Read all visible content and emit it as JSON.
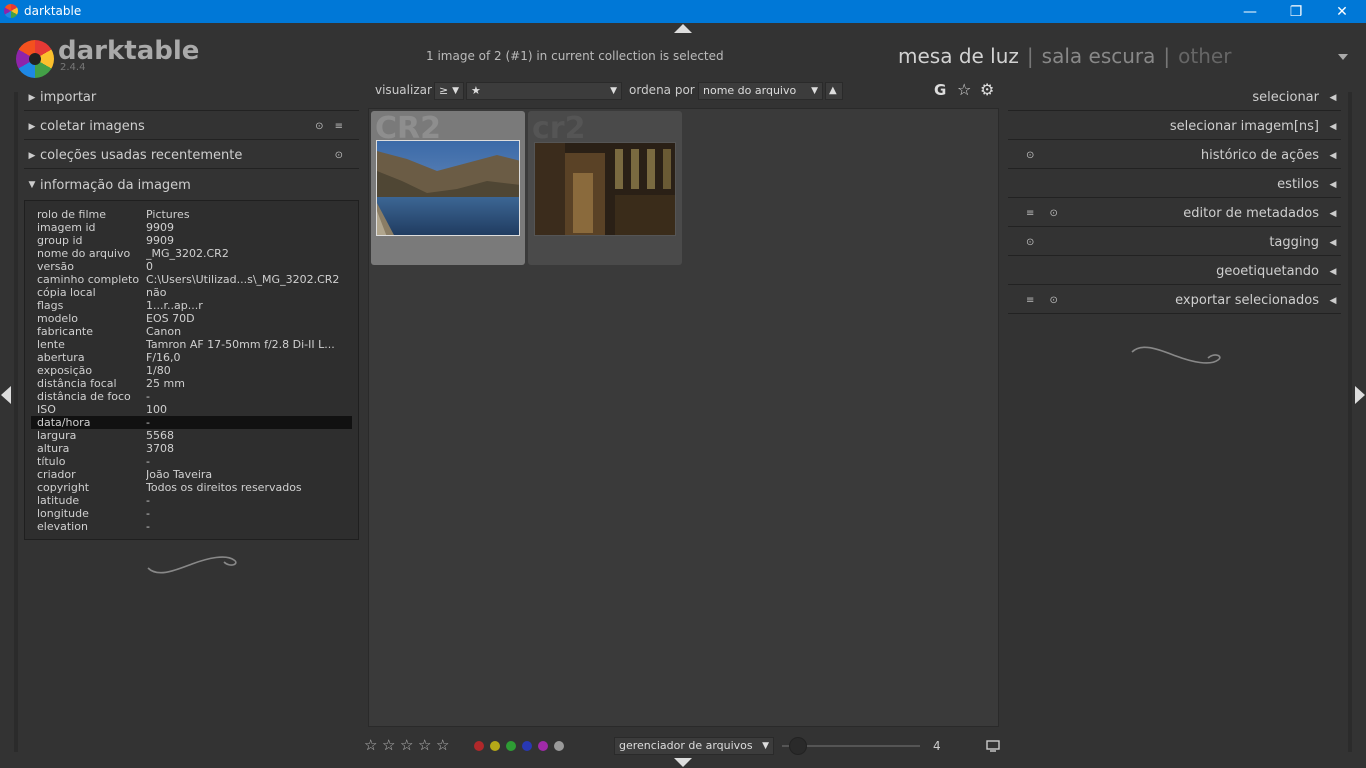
{
  "window": {
    "title": "darktable",
    "minimize": "—",
    "maximize": "❐",
    "close": "✕"
  },
  "logo": {
    "name": "darktable",
    "version": "2.4.4"
  },
  "status": "1 image of 2 (#1) in current collection is selected",
  "views": {
    "active": "mesa de luz",
    "second": "sala escura",
    "third": "other",
    "separator": "|"
  },
  "left_modules": [
    {
      "label": "importar",
      "expanded": false,
      "icons": ""
    },
    {
      "label": "coletar imagens",
      "expanded": false,
      "icons": "⊙ ≡"
    },
    {
      "label": "coleções usadas recentemente",
      "expanded": false,
      "icons": "⊙"
    },
    {
      "label": "informação da imagem",
      "expanded": true,
      "icons": ""
    }
  ],
  "image_info": [
    {
      "k": "rolo de filme",
      "v": "Pictures"
    },
    {
      "k": "imagem id",
      "v": "9909"
    },
    {
      "k": "group id",
      "v": "9909"
    },
    {
      "k": "nome do arquivo",
      "v": "_MG_3202.CR2"
    },
    {
      "k": "versão",
      "v": "0"
    },
    {
      "k": "caminho completo",
      "v": "C:\\Users\\Utilizad...s\\_MG_3202.CR2"
    },
    {
      "k": "cópia local",
      "v": "não"
    },
    {
      "k": "flags",
      "v": "1...r..ap...r"
    },
    {
      "k": "modelo",
      "v": "EOS 70D"
    },
    {
      "k": "fabricante",
      "v": "Canon"
    },
    {
      "k": "lente",
      "v": "Tamron AF 17-50mm f/2.8 Di-II L..."
    },
    {
      "k": "abertura",
      "v": "F/16,0"
    },
    {
      "k": "exposição",
      "v": "1/80"
    },
    {
      "k": "distância focal",
      "v": "25 mm"
    },
    {
      "k": "distância de foco",
      "v": "-"
    },
    {
      "k": "ISO",
      "v": "100"
    },
    {
      "k": "data/hora",
      "v": "-"
    },
    {
      "k": "largura",
      "v": "5568"
    },
    {
      "k": "altura",
      "v": "3708"
    },
    {
      "k": "título",
      "v": "-"
    },
    {
      "k": "criador",
      "v": "João Taveira"
    },
    {
      "k": "copyright",
      "v": "Todos os direitos reservados"
    },
    {
      "k": "latitude",
      "v": "-"
    },
    {
      "k": "longitude",
      "v": "-"
    },
    {
      "k": "elevation",
      "v": "-"
    }
  ],
  "right_modules": [
    {
      "label": "selecionar",
      "icons": ""
    },
    {
      "label": "selecionar imagem[ns]",
      "icons": ""
    },
    {
      "label": "histórico de ações",
      "icons": "⊙"
    },
    {
      "label": "estilos",
      "icons": ""
    },
    {
      "label": "editor de metadados",
      "icons": "≡ ⊙"
    },
    {
      "label": "tagging",
      "icons": "⊙"
    },
    {
      "label": "geoetiquetando",
      "icons": ""
    },
    {
      "label": "exportar selecionados",
      "icons": "≡ ⊙"
    }
  ],
  "toolbar": {
    "visualizar_label": "visualizar",
    "comparator": "≥",
    "rating_filter": "★",
    "sort_label": "ordena por",
    "sort_value": "nome do arquivo",
    "sort_dir": "▲",
    "grouping": "G",
    "star_icon": "☆",
    "gear_icon": "⚙"
  },
  "thumbnails": [
    {
      "ext": "CR2",
      "selected": true
    },
    {
      "ext": "cr2",
      "selected": false
    }
  ],
  "bottom": {
    "stars": [
      "☆",
      "☆",
      "☆",
      "☆",
      "☆"
    ],
    "color_labels": [
      "#b0282a",
      "#b5a818",
      "#2e9c34",
      "#2838b4",
      "#a02aa8",
      "#9a9a9a"
    ],
    "layout_value": "gerenciador de arquivos",
    "zoom_value": "4",
    "display_icon": "🖵"
  },
  "decor": {
    "squiggle": "∽"
  }
}
